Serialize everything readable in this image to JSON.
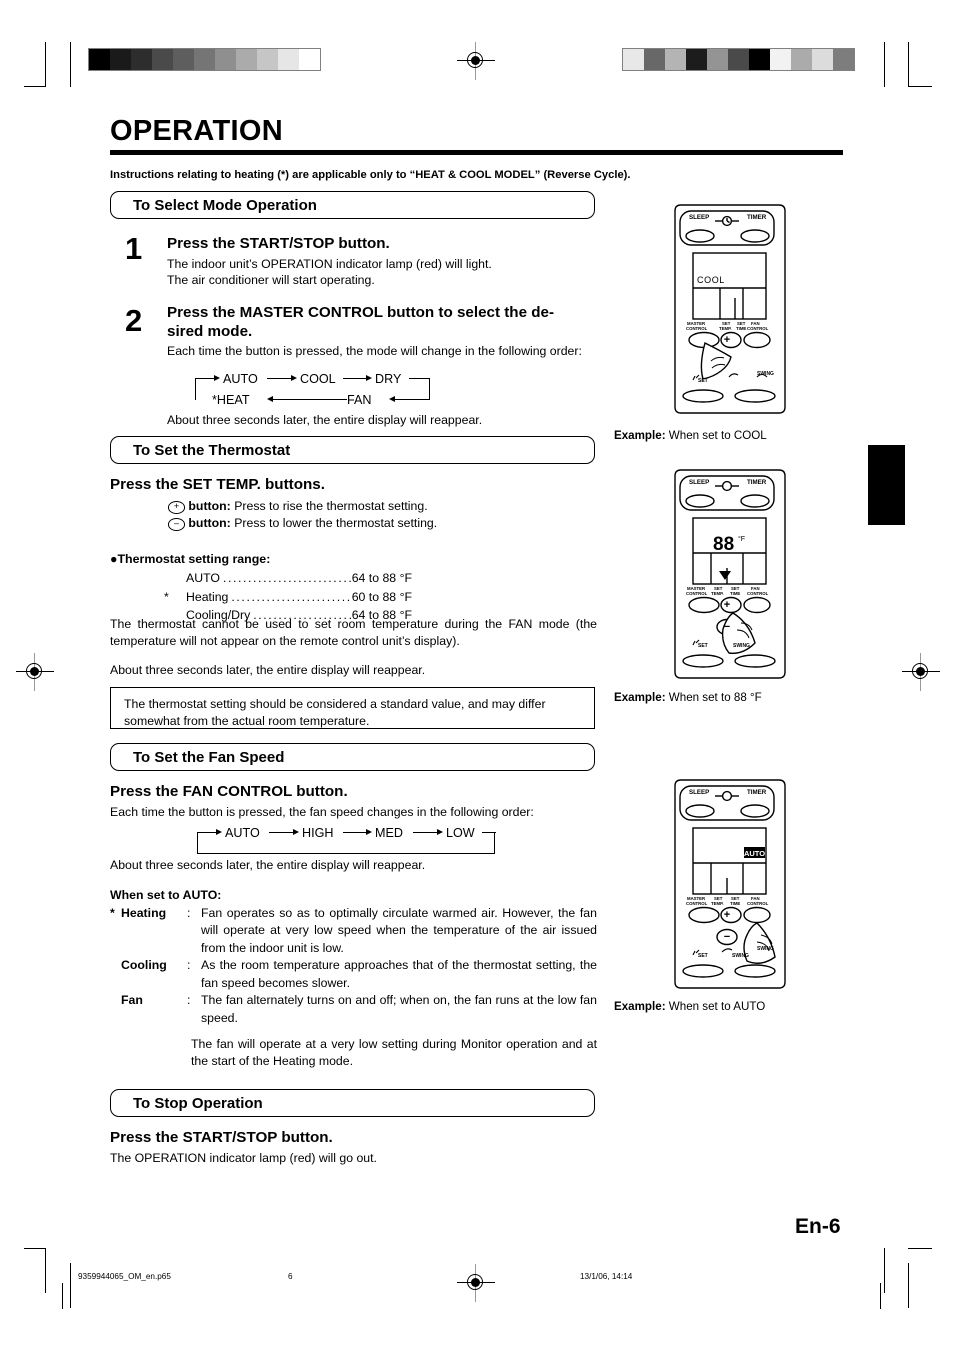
{
  "page": {
    "title": "OPERATION",
    "intro": "Instructions relating to heating (*) are applicable only to “HEAT & COOL MODEL” (Reverse Cycle).",
    "folio": "En-6"
  },
  "sections": {
    "select_mode": {
      "header": "To Select Mode Operation",
      "steps": [
        {
          "number": "1",
          "heading": "Press the START/STOP button.",
          "lines": [
            "The indoor unit’s OPERATION indicator lamp (red) will light.",
            "The air conditioner will start operating."
          ]
        },
        {
          "number": "2",
          "heading": "Press the MASTER CONTROL button to select the de-sired mode.",
          "heading_line1": "Press the MASTER CONTROL button to select the de-",
          "heading_line2": "sired mode.",
          "lines": [
            "Each time the button is pressed, the mode will change in the following order:"
          ],
          "footer": "About three seconds later, the entire display will reappear."
        }
      ],
      "mode_flow": {
        "top": [
          "AUTO",
          "COOL",
          "DRY"
        ],
        "bottom": [
          "*HEAT",
          "FAN"
        ]
      }
    },
    "thermostat": {
      "header": "To Set the Thermostat",
      "heading": "Press the SET TEMP. buttons.",
      "buttons": [
        {
          "glyph": "+",
          "label": "button:",
          "text": "Press to rise the thermostat setting."
        },
        {
          "glyph": "–",
          "label": "button:",
          "text": "Press to lower the thermostat setting."
        }
      ],
      "range_title": "Thermostat setting range:",
      "ranges": [
        {
          "star": "",
          "name": "AUTO",
          "value": "64 to 88 °F"
        },
        {
          "star": "*",
          "name": "Heating",
          "value": "60 to 88 °F"
        },
        {
          "star": "",
          "name": "Cooling/Dry",
          "value": "64 to 88 °F"
        }
      ],
      "note_fan_mode": "The thermostat cannot be used to set room temperature during the FAN mode (the temperature will not appear on the remote control unit’s display).",
      "footer": "About three seconds later, the entire display will reappear.",
      "note_box": "The thermostat setting should be considered a standard value, and may differ somewhat from the actual room temperature."
    },
    "fan_speed": {
      "header": "To Set the Fan Speed",
      "heading": "Press the FAN CONTROL button.",
      "lines": [
        "Each time the button is pressed, the fan speed changes in the following order:"
      ],
      "fan_flow": [
        "AUTO",
        "HIGH",
        "MED",
        "LOW"
      ],
      "footer": "About three seconds later, the entire display will reappear.",
      "auto_title": "When set to AUTO:",
      "auto_rows": [
        {
          "star": "*",
          "label": "Heating",
          "colon": ":",
          "text": "Fan operates so as to optimally circulate warmed air. However, the fan will operate at very low speed when the temperature of the air issued from the indoor unit is low."
        },
        {
          "star": "",
          "label": "Cooling",
          "colon": ":",
          "text": "As the room temperature approaches that of the thermostat setting, the fan speed becomes slower."
        },
        {
          "star": "",
          "label": "Fan",
          "colon": ":",
          "text": "The fan alternately turns on and off; when on, the fan runs at the low fan speed."
        }
      ],
      "auto_trailing": "The fan will operate at a very low setting during Monitor operation and at the start of the Heating mode."
    },
    "stop": {
      "header": "To Stop Operation",
      "heading": "Press the START/STOP button.",
      "lines": [
        "The OPERATION indicator lamp (red) will go out."
      ]
    }
  },
  "remotes": [
    {
      "caption_label": "Example:",
      "caption_text": "When set to COOL",
      "top_left_label": "SLEEP",
      "top_right_label": "TIMER",
      "lcd_text": "COOL",
      "lcd_position": "left",
      "button_labels": [
        "MASTER CONTROL",
        "SET TEMP.",
        "SET TIME",
        "FAN CONTROL"
      ],
      "bottom_labels": [
        "SET",
        "SWING"
      ],
      "pressed_button": "master-control"
    },
    {
      "caption_label": "Example:",
      "caption_text": "When set to 88 °F",
      "top_left_label": "SLEEP",
      "top_right_label": "TIMER",
      "lcd_text": "88",
      "lcd_unit": "°F",
      "lcd_position": "center",
      "button_labels": [
        "MASTER CONTROL",
        "SET TEMP.",
        "SET TIME",
        "FAN CONTROL"
      ],
      "bottom_labels": [
        "SET",
        "SWING",
        "SET",
        "SWING"
      ],
      "pressed_button": "plus"
    },
    {
      "caption_label": "Example:",
      "caption_text": "When set to AUTO",
      "top_left_label": "SLEEP",
      "top_right_label": "TIMER",
      "lcd_text": "AUTO",
      "lcd_position": "right",
      "button_labels": [
        "MASTER CONTROL",
        "SET TEMP.",
        "SET TIME",
        "FAN CONTROL"
      ],
      "bottom_labels": [
        "SET",
        "SWING",
        "SET",
        "SWING"
      ],
      "pressed_button": "fan-control"
    }
  ],
  "footer": {
    "filename": "9359944065_OM_en.p65",
    "page_number": "6",
    "timestamp": "13/1/06, 14:14"
  },
  "calibration": {
    "left_bar": [
      "#000000",
      "#1a1a1a",
      "#2d2d2d",
      "#4a4a4a",
      "#5e5e5e",
      "#757575",
      "#8f8f8f",
      "#ababab",
      "#c6c6c6",
      "#e6e6e6",
      "#ffffff"
    ],
    "right_bar": [
      "#e8e8e8",
      "#686868",
      "#b4b4b4",
      "#1c1c1c",
      "#949494",
      "#4a4a4a",
      "#000000",
      "#f2f2f2",
      "#ababab",
      "#dcdcdc",
      "#7d7d7d"
    ]
  }
}
